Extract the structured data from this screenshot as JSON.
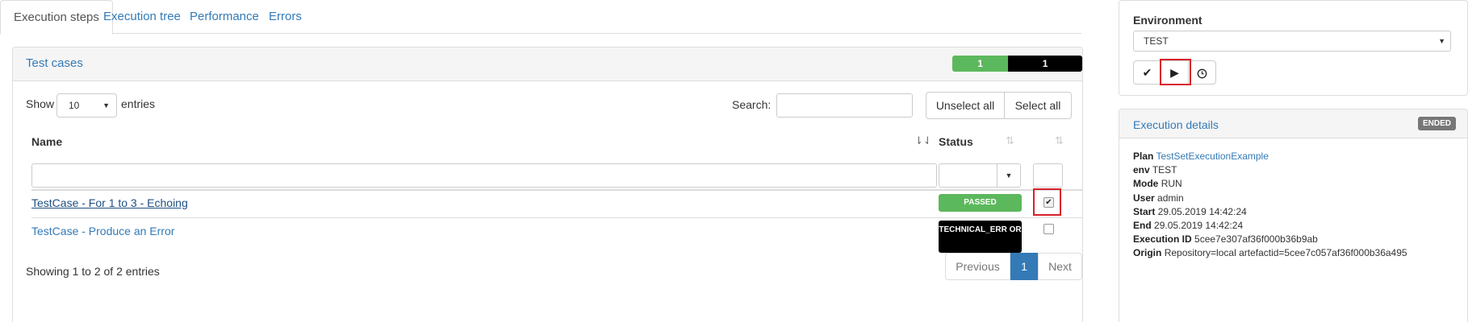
{
  "tabs": [
    {
      "label": "Execution steps"
    },
    {
      "label": "Execution tree"
    },
    {
      "label": "Performance"
    },
    {
      "label": "Errors"
    }
  ],
  "test_cases": {
    "title": "Test cases",
    "progress": [
      {
        "value": "1",
        "color": "#5cb85c",
        "fraction": 0.43
      },
      {
        "value": "1",
        "color": "#000000",
        "fraction": 0.57
      }
    ],
    "show_label": "Show",
    "entries_value": "10",
    "entries_label": "entries",
    "search_label": "Search:",
    "unselect_all": "Unselect all",
    "select_all": "Select all",
    "columns": {
      "name": "Name",
      "status": "Status"
    },
    "rows": [
      {
        "name": "TestCase - For 1 to 3 - Echoing",
        "status": "PASSED",
        "checked": true
      },
      {
        "name": "TestCase - Produce an Error",
        "status": "TECHNICAL_ERR OR",
        "checked": false
      }
    ],
    "showing": "Showing 1 to 2 of 2 entries",
    "pagination": {
      "previous": "Previous",
      "page": "1",
      "next": "Next"
    }
  },
  "environment": {
    "title": "Environment",
    "selected": "TEST",
    "buttons": [
      "check-icon",
      "play-icon",
      "clock-icon"
    ]
  },
  "execution_details": {
    "title": "Execution details",
    "badge": "ENDED",
    "items": [
      {
        "key": "Plan",
        "value": "TestSetExecutionExample"
      },
      {
        "key": "env",
        "value": "TEST"
      },
      {
        "key": "Mode",
        "value": "RUN"
      },
      {
        "key": "User",
        "value": "admin"
      },
      {
        "key": "Start",
        "value": "29.05.2019 14:42:24"
      },
      {
        "key": "End",
        "value": "29.05.2019 14:42:24"
      },
      {
        "key": "Execution ID",
        "value": "5cee7e307af36f000b36b9ab"
      },
      {
        "key": "Origin",
        "value": "Repository=local artefactid=5cee7c057af36f000b36a495"
      }
    ]
  }
}
